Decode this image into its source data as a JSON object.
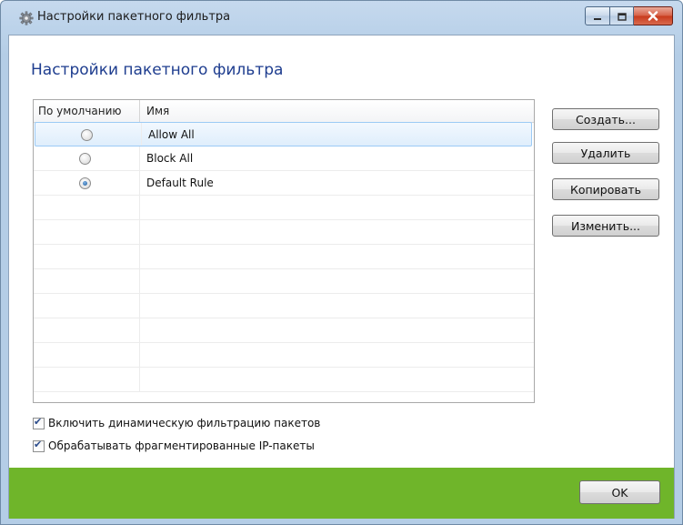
{
  "window": {
    "title": "Настройки пакетного фильтра",
    "icon": "gear-icon",
    "caption_buttons": [
      "minimize-icon",
      "maximize-icon",
      "close-icon"
    ]
  },
  "dialog": {
    "heading": "Настройки пакетного фильтра"
  },
  "grid": {
    "columns": [
      "По умолчанию",
      "Имя"
    ],
    "rows": [
      {
        "name": "Allow All",
        "default": false,
        "selected": true
      },
      {
        "name": "Block All",
        "default": false,
        "selected": false
      },
      {
        "name": "Default Rule",
        "default": true,
        "selected": false
      }
    ]
  },
  "buttons": {
    "create": "Создать...",
    "delete": "Удалить",
    "copy": "Копировать",
    "edit": "Изменить..."
  },
  "options": {
    "dynamic_filter": {
      "label": "Включить динамическую фильтрацию пакетов",
      "checked": true
    },
    "fragmented": {
      "label": "Обрабатывать фрагментированные IP-пакеты",
      "checked": true
    }
  },
  "footer": {
    "ok": "OK",
    "color": "#6fb52a"
  }
}
